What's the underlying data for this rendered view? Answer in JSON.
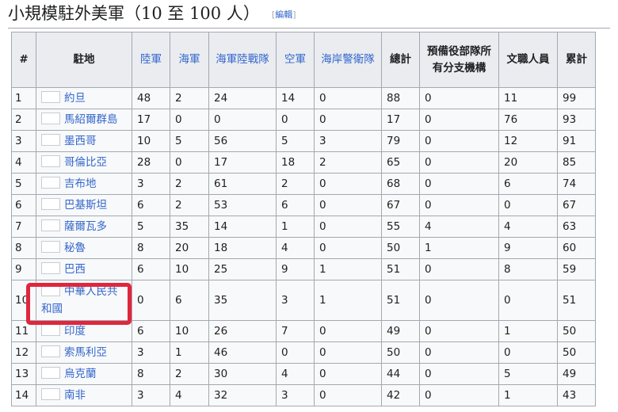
{
  "section": {
    "title": "小規模駐外美軍（10 至 100 人）",
    "edit_open": "[",
    "edit_label": "編輯",
    "edit_close": "]"
  },
  "table": {
    "headers": [
      {
        "key": "rank",
        "label": "#",
        "link": false
      },
      {
        "key": "location",
        "label": "駐地",
        "link": false
      },
      {
        "key": "army",
        "label": "陸軍",
        "link": true
      },
      {
        "key": "navy",
        "label": "海軍",
        "link": true
      },
      {
        "key": "marines",
        "label": "海軍陸戰隊",
        "link": true
      },
      {
        "key": "air_force",
        "label": "空軍",
        "link": true
      },
      {
        "key": "coast_guard",
        "label": "海岸警衛隊",
        "link": true
      },
      {
        "key": "total",
        "label": "總計",
        "link": false
      },
      {
        "key": "reserve",
        "label": "預備役部隊所有分支機構",
        "link": false
      },
      {
        "key": "civilian",
        "label": "文職人員",
        "link": false
      },
      {
        "key": "cumulative",
        "label": "累計",
        "link": false
      }
    ],
    "rows": [
      [
        "1",
        "約旦",
        "48",
        "2",
        "24",
        "14",
        "0",
        "88",
        "0",
        "11",
        "99"
      ],
      [
        "2",
        "馬紹爾群島",
        "17",
        "0",
        "0",
        "0",
        "0",
        "17",
        "0",
        "76",
        "93"
      ],
      [
        "3",
        "墨西哥",
        "10",
        "5",
        "56",
        "5",
        "3",
        "79",
        "0",
        "12",
        "91"
      ],
      [
        "4",
        "哥倫比亞",
        "28",
        "0",
        "17",
        "18",
        "2",
        "65",
        "0",
        "20",
        "85"
      ],
      [
        "5",
        "吉布地",
        "3",
        "2",
        "61",
        "2",
        "0",
        "68",
        "0",
        "6",
        "74"
      ],
      [
        "6",
        "巴基斯坦",
        "6",
        "2",
        "53",
        "6",
        "0",
        "67",
        "0",
        "0",
        "67"
      ],
      [
        "7",
        "薩爾瓦多",
        "5",
        "35",
        "14",
        "1",
        "0",
        "55",
        "4",
        "4",
        "63"
      ],
      [
        "8",
        "秘魯",
        "8",
        "20",
        "18",
        "4",
        "0",
        "50",
        "1",
        "9",
        "60"
      ],
      [
        "9",
        "巴西",
        "6",
        "10",
        "25",
        "9",
        "1",
        "51",
        "0",
        "8",
        "59"
      ],
      [
        "10",
        "中華人民共和國",
        "0",
        "6",
        "35",
        "3",
        "1",
        "51",
        "0",
        "0",
        "51"
      ],
      [
        "11",
        "印度",
        "6",
        "10",
        "26",
        "7",
        "0",
        "49",
        "0",
        "1",
        "50"
      ],
      [
        "12",
        "索馬利亞",
        "3",
        "1",
        "46",
        "0",
        "0",
        "50",
        "0",
        "0",
        "50"
      ],
      [
        "13",
        "烏克蘭",
        "8",
        "2",
        "30",
        "4",
        "0",
        "44",
        "0",
        "5",
        "49"
      ],
      [
        "14",
        "南非",
        "3",
        "4",
        "32",
        "3",
        "0",
        "42",
        "0",
        "1",
        "43"
      ]
    ],
    "highlighted_row": "10",
    "highlight_color": "#e0263d"
  }
}
